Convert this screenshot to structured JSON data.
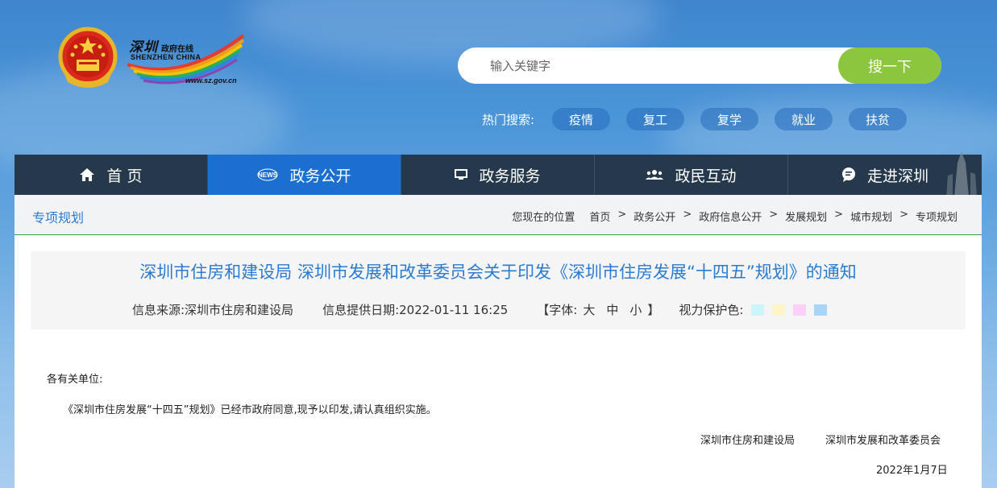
{
  "logo": {
    "cn_title": "深圳",
    "cn_sub": "政府在线",
    "en_title": "SHENZHEN CHINA",
    "url": "www.sz.gov.cn"
  },
  "search": {
    "placeholder": "输入关键字",
    "button": "搜一下"
  },
  "hot_search": {
    "label": "热门搜索:",
    "tags": [
      "疫情",
      "复工",
      "复学",
      "就业",
      "扶贫"
    ]
  },
  "nav": {
    "items": [
      {
        "label": "首 页",
        "icon": "home-icon"
      },
      {
        "label": "政务公开",
        "icon": "news-icon",
        "icon_text": "NEWS"
      },
      {
        "label": "政务服务",
        "icon": "monitor-icon"
      },
      {
        "label": "政民互动",
        "icon": "people-icon"
      },
      {
        "label": "走进深圳",
        "icon": "chat-bubble-icon"
      }
    ],
    "active_index": 1
  },
  "breadcrumb": {
    "section": "专项规划",
    "prefix": "您现在的位置",
    "items": [
      "首页",
      "政务公开",
      "政府信息公开",
      "发展规划",
      "城市规划",
      "专项规划"
    ],
    "separator": ">"
  },
  "article": {
    "title": "深圳市住房和建设局 深圳市发展和改革委员会关于印发《深圳市住房发展“十四五”规划》的通知",
    "source": "信息来源:深圳市住房和建设局",
    "date": "信息提供日期:2022-01-11 16:25",
    "font_open": "【字体:",
    "font_sizes": [
      "大",
      "中",
      "小"
    ],
    "font_close": "】",
    "eye_label": "视力保护色:",
    "eye_colors": [
      "#ccf5fa",
      "#fbf5c8",
      "#fbcff8",
      "#a8d5f8"
    ],
    "salutation": "各有关单位:",
    "paragraph": "《深圳市住房发展“十四五”规划》已经市政府同意,现予以印发,请认真组织实施。",
    "signers": [
      "深圳市住房和建设局",
      "深圳市发展和改革委员会"
    ],
    "sign_date": "2022年1月7日"
  },
  "colors": {
    "nav_bg": "#25384c",
    "nav_active": "#1a6fd1",
    "accent_blue": "#2b7bd0",
    "search_button": "#8cc63f",
    "divider_green": "#2e9f4d"
  }
}
